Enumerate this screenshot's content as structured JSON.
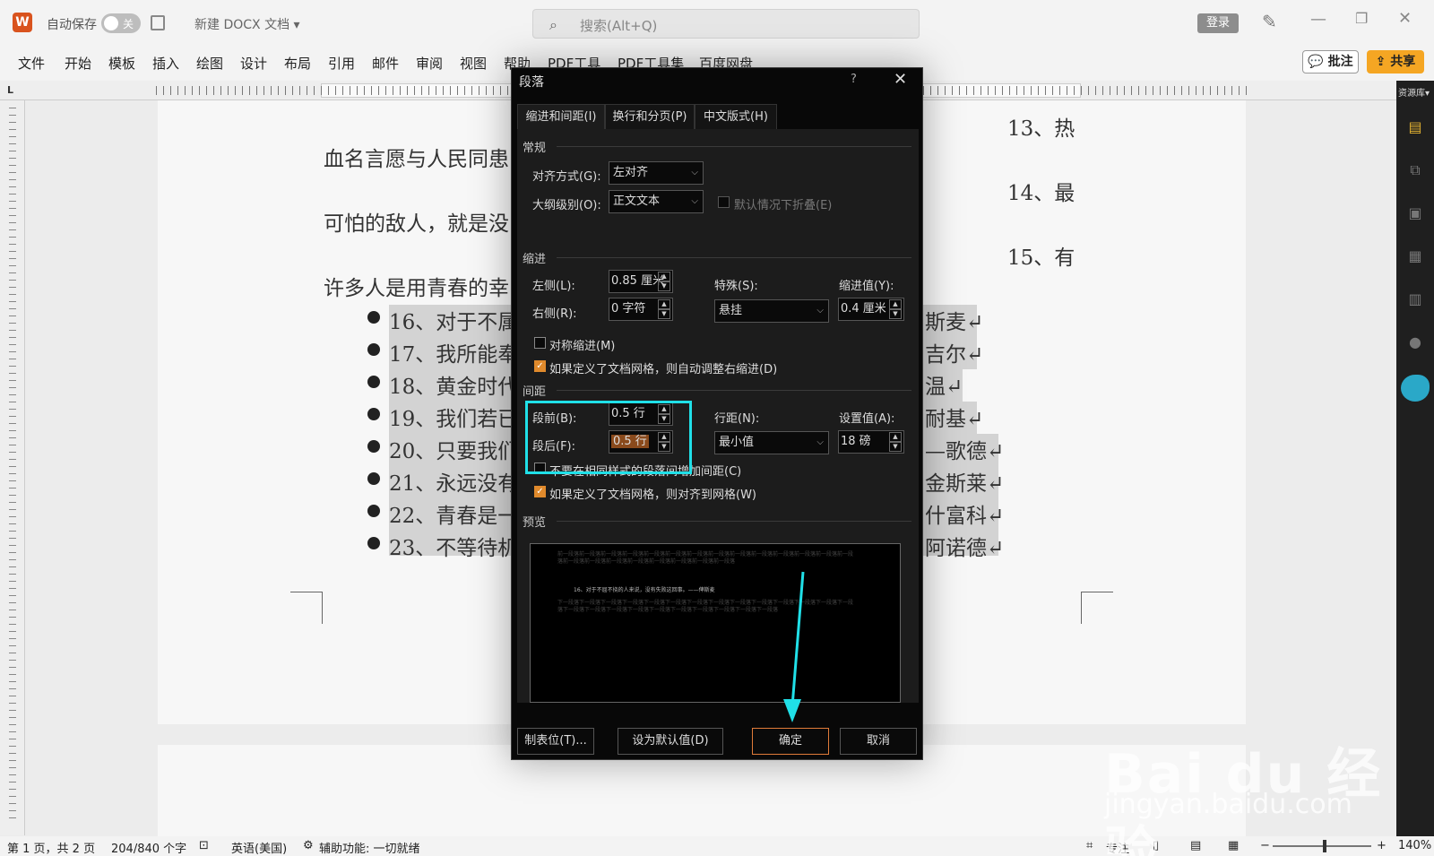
{
  "titlebar": {
    "logo": "W",
    "autosave_label": "自动保存",
    "autosave_state": "关",
    "doc_title": "新建 DOCX 文档 ▾",
    "search_placeholder": "搜索(Alt+Q)",
    "login": "登录",
    "min_icon": "—",
    "max_icon": "❐",
    "close_icon": "✕"
  },
  "menubar": {
    "items": [
      "文件",
      "开始",
      "模板",
      "插入",
      "绘图",
      "设计",
      "布局",
      "引用",
      "邮件",
      "审阅",
      "视图",
      "帮助",
      "PDF工具",
      "PDF工具集",
      "百度网盘"
    ],
    "comments": "💬 批注",
    "share": "⇪ 共享"
  },
  "ruler": {
    "corner": "L"
  },
  "document": {
    "lines": [
      "血名言愿与人民同患",
      "可怕的敌人，就是没",
      "许多人是用青春的幸"
    ],
    "right_lines": [
      "13、热",
      "14、最",
      "15、有"
    ],
    "bullets": [
      {
        "left": "16、对于不属",
        "right": "斯麦↵"
      },
      {
        "left": "17、我所能奉",
        "right": "吉尔↵"
      },
      {
        "left": "18、黄金时代",
        "right": "温↵"
      },
      {
        "left": "19、我们若已",
        "right": "耐基↵"
      },
      {
        "left": "20、只要我们",
        "right": "—歌德↵"
      },
      {
        "left": "21、永远没有",
        "right": "金斯莱↵"
      },
      {
        "left": "22、青春是一",
        "right": "什富科↵"
      },
      {
        "left": "23、不等待机",
        "right": "阿诺德↵"
      }
    ]
  },
  "right_panel": {
    "label": "资源库▾"
  },
  "statusbar": {
    "page": "第 1 页，共 2 页",
    "words": "204/840 个字",
    "language": "英语(美国)",
    "accessibility": "辅助功能: 一切就绪",
    "focus": "专注",
    "zoom": "140%"
  },
  "dialog": {
    "title": "段落",
    "help": "?",
    "close": "✕",
    "tabs": [
      "缩进和间距(I)",
      "换行和分页(P)",
      "中文版式(H)"
    ],
    "general": {
      "section": "常规",
      "alignment_label": "对齐方式(G):",
      "alignment_value": "左对齐",
      "outline_label": "大纲级别(O):",
      "outline_value": "正文文本",
      "collapse_label": "默认情况下折叠(E)"
    },
    "indent": {
      "section": "缩进",
      "left_label": "左侧(L):",
      "left_value": "0.85 厘米",
      "right_label": "右侧(R):",
      "right_value": "0 字符",
      "special_label": "特殊(S):",
      "special_value": "悬挂",
      "by_label": "缩进值(Y):",
      "by_value": "0.4 厘米",
      "mirror_label": "对称缩进(M)",
      "auto_adjust_label": "如果定义了文档网格，则自动调整右缩进(D)"
    },
    "spacing": {
      "section": "间距",
      "before_label": "段前(B):",
      "before_value": "0.5 行",
      "after_label": "段后(F):",
      "after_value": "0.5 行",
      "line_label": "行距(N):",
      "line_value": "最小值",
      "at_label": "设置值(A):",
      "at_value": "18 磅",
      "no_space_label": "不要在相同样式的段落间增加间距(C)",
      "snap_grid_label": "如果定义了文档网格，则对齐到网格(W)"
    },
    "preview": {
      "section": "预览",
      "prev_text": "前一段落前一段落前一段落前一段落前一段落前一段落前一段落前一段落前一段落前一段落前一段落前一段落前一段落前一段落前一段落前一段落前一段落前一段落前一段落前一段落前一段落前一段落",
      "main_text": "16、对于不屈不挠的人来说，没有失败这回事。——俾斯麦",
      "next_text": "下一段落下一段落下一段落下一段落下一段落下一段落下一段落下一段落下一段落下一段落下一段落下一段落下一段落下一段落下一段落下一段落下一段落下一段落下一段落下一段落下一段落下一段落下一段落下一段落"
    },
    "buttons": {
      "tabs": "制表位(T)...",
      "default": "设为默认值(D)",
      "ok": "确定",
      "cancel": "取消"
    }
  },
  "watermark": {
    "text": "Bai du 经验",
    "url": "jingyan.baidu.com"
  },
  "colors": {
    "highlight": "#20e0e8",
    "accent": "#e08a2c",
    "share": "#f5a623"
  }
}
